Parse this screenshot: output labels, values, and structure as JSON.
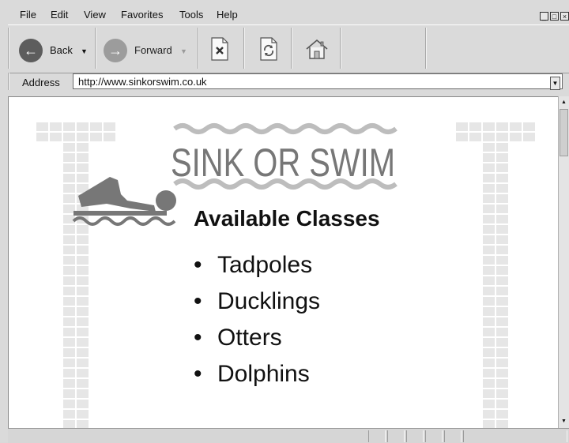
{
  "menu": {
    "items": [
      "File",
      "Edit",
      "View",
      "Favorites",
      "Tools",
      "Help"
    ]
  },
  "window_controls": [
    "minimize",
    "maximize",
    "close"
  ],
  "toolbar": {
    "back_label": "Back",
    "forward_label": "Forward",
    "back_icon": "arrow-left-icon",
    "forward_icon": "arrow-right-icon",
    "stop_icon": "stop-icon",
    "refresh_icon": "refresh-icon",
    "home_icon": "home-icon"
  },
  "address": {
    "label": "Address",
    "url": "http://www.sinkorswim.co.uk"
  },
  "page": {
    "logo_text": "SINK OR SWIM",
    "heading": "Available Classes",
    "classes": [
      "Tadpoles",
      "Ducklings",
      "Otters",
      "Dolphins"
    ],
    "bullet": "•",
    "colors": {
      "logo_gray": "#777777",
      "wave_gray": "#bdbdbd",
      "tile_gray": "#e6e6e6"
    }
  }
}
